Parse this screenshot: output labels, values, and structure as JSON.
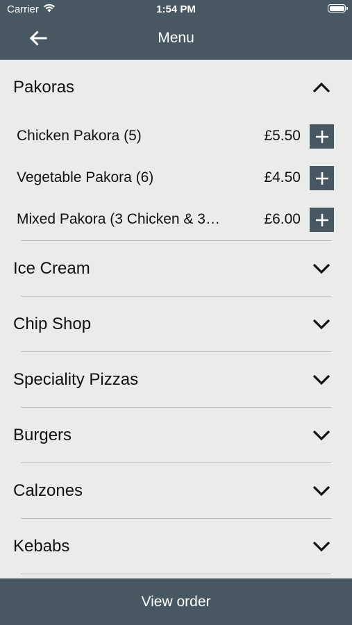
{
  "status_bar": {
    "carrier": "Carrier",
    "time": "1:54 PM",
    "wifi_icon": "wifi-icon",
    "battery_icon": "battery-icon"
  },
  "nav": {
    "title": "Menu",
    "back_icon": "arrow-left-icon"
  },
  "colors": {
    "bar": "#475862",
    "background": "#ebebeb",
    "divider": "#b8b8b8"
  },
  "sections": [
    {
      "title": "Pakoras",
      "expanded": true,
      "items": [
        {
          "name": "Chicken Pakora (5)",
          "price": "£5.50"
        },
        {
          "name": "Vegetable Pakora (6)",
          "price": "£4.50"
        },
        {
          "name": "Mixed Pakora (3 Chicken & 3…",
          "price": "£6.00"
        }
      ]
    },
    {
      "title": "Ice Cream",
      "expanded": false
    },
    {
      "title": "Chip Shop",
      "expanded": false
    },
    {
      "title": "Speciality Pizzas",
      "expanded": false
    },
    {
      "title": "Burgers",
      "expanded": false
    },
    {
      "title": "Calzones",
      "expanded": false
    },
    {
      "title": "Kebabs",
      "expanded": false
    }
  ],
  "footer": {
    "view_order_label": "View order"
  }
}
